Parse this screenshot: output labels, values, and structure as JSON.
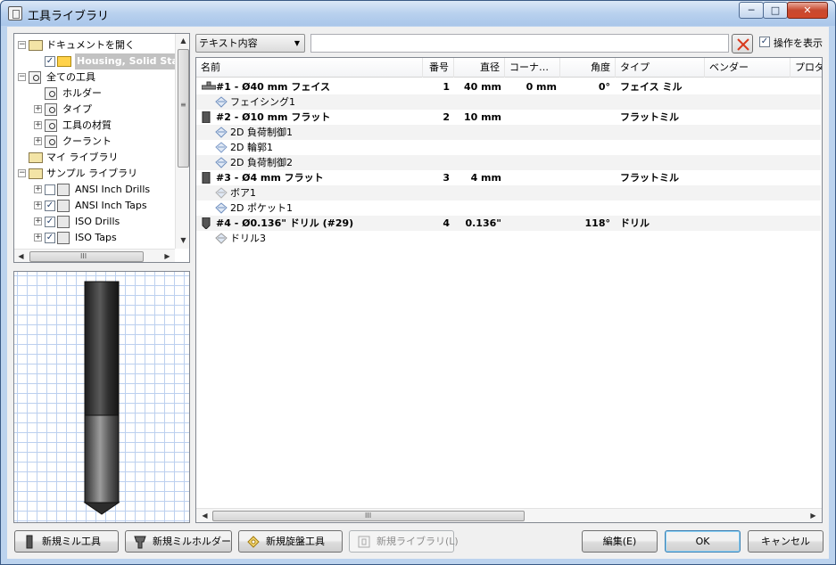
{
  "window": {
    "title": "工具ライブラリ",
    "controls": {
      "minimize": "─",
      "maximize": "□",
      "close": "✕"
    }
  },
  "tree": {
    "items": [
      {
        "label": "ドキュメントを開く",
        "expander": "−",
        "icon": "open-folder-icon"
      },
      {
        "label": "Housing, Solid Stat",
        "checked": true,
        "icon": "document-icon",
        "selected": true
      },
      {
        "label": "全ての工具",
        "expander": "−",
        "icon": "search-folder-icon"
      },
      {
        "label": "ホルダー",
        "icon": "search-folder-icon"
      },
      {
        "label": "タイプ",
        "expander": "+",
        "icon": "search-folder-icon"
      },
      {
        "label": "工具の材質",
        "expander": "+",
        "icon": "search-folder-icon"
      },
      {
        "label": "クーラント",
        "expander": "+",
        "icon": "search-folder-icon"
      },
      {
        "label": "マイ ライブラリ",
        "icon": "folder-icon"
      },
      {
        "label": "サンプル ライブラリ",
        "expander": "−",
        "icon": "folder-icon"
      },
      {
        "label": "ANSI Inch Drills",
        "expander": "+",
        "checked": false,
        "icon": "library-icon"
      },
      {
        "label": "ANSI Inch Taps",
        "expander": "+",
        "checked": true,
        "icon": "library-icon"
      },
      {
        "label": "ISO Drills",
        "expander": "+",
        "checked": true,
        "icon": "library-icon"
      },
      {
        "label": "ISO Taps",
        "expander": "+",
        "checked": true,
        "icon": "library-icon"
      }
    ],
    "scroll_grip": "≡",
    "hscroll_grip": "III"
  },
  "filter": {
    "mode": "テキスト内容",
    "text": "",
    "show_operations_label": "操作を表示",
    "show_operations_checked": true
  },
  "list": {
    "columns": [
      "名前",
      "番号",
      "直径",
      "コーナ…",
      "角度",
      "タイプ",
      "ベンダー",
      "プロダ"
    ],
    "rows": [
      {
        "kind": "tool",
        "icon": "face-mill-icon",
        "name": "#1 - Ø40 mm フェイス",
        "number": "1",
        "diameter": "40 mm",
        "corner": "0 mm",
        "angle": "0°",
        "type": "フェイス ミル"
      },
      {
        "kind": "op",
        "icon": "facing-op-icon",
        "name": "フェイシング1"
      },
      {
        "kind": "tool",
        "icon": "flat-mill-icon",
        "name": "#2 - Ø10 mm フラット",
        "number": "2",
        "diameter": "10 mm",
        "corner": "",
        "angle": "",
        "type": "フラットミル"
      },
      {
        "kind": "op",
        "icon": "adaptive-op-icon",
        "name": "2D 負荷制御1"
      },
      {
        "kind": "op",
        "icon": "contour-op-icon",
        "name": "2D 輪郭1"
      },
      {
        "kind": "op",
        "icon": "adaptive-op-icon",
        "name": "2D 負荷制御2"
      },
      {
        "kind": "tool",
        "icon": "flat-mill-icon",
        "name": "#3 - Ø4 mm フラット",
        "number": "3",
        "diameter": "4 mm",
        "corner": "",
        "angle": "",
        "type": "フラットミル"
      },
      {
        "kind": "op",
        "icon": "bore-op-icon",
        "name": "ボア1"
      },
      {
        "kind": "op",
        "icon": "pocket-op-icon",
        "name": "2D ポケット1"
      },
      {
        "kind": "tool",
        "icon": "drill-icon",
        "name": "#4 - Ø0.136\" ドリル (#29)",
        "number": "4",
        "diameter": "0.136\"",
        "corner": "",
        "angle": "118°",
        "type": "ドリル"
      },
      {
        "kind": "op",
        "icon": "drill-op-icon",
        "name": "ドリル3"
      }
    ],
    "hscroll_grip": "III"
  },
  "buttons": {
    "new_mill_tool": "新規ミル工具",
    "new_mill_holder": "新規ミルホルダー",
    "new_lathe_tool": "新規旋盤工具",
    "new_library": "新規ライブラリ(L)",
    "edit": "編集(E)",
    "ok": "OK",
    "cancel": "キャンセル"
  },
  "colors": {
    "title_gradient": "#b9d1ee",
    "selection": "#c2c2c2",
    "grid_line": "#bcd0ef",
    "clear_x": "#d83a1e"
  }
}
